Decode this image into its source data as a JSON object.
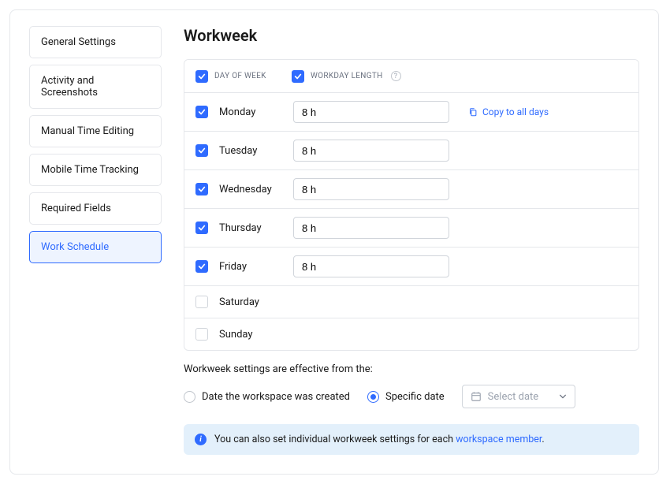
{
  "sidebar": {
    "items": [
      {
        "label": "General Settings",
        "active": false
      },
      {
        "label": "Activity and Screenshots",
        "active": false
      },
      {
        "label": "Manual Time Editing",
        "active": false
      },
      {
        "label": "Mobile Time Tracking",
        "active": false
      },
      {
        "label": "Required Fields",
        "active": false
      },
      {
        "label": "Work Schedule",
        "active": true
      }
    ]
  },
  "page": {
    "title": "Workweek"
  },
  "table": {
    "col_day": "Day of Week",
    "col_len": "Workday Length",
    "header_check_day": true,
    "header_check_len": true,
    "copy_label": "Copy to all days",
    "days": [
      {
        "name": "Monday",
        "checked": true,
        "length": "8 h",
        "show_copy": true
      },
      {
        "name": "Tuesday",
        "checked": true,
        "length": "8 h",
        "show_copy": false
      },
      {
        "name": "Wednesday",
        "checked": true,
        "length": "8 h",
        "show_copy": false
      },
      {
        "name": "Thursday",
        "checked": true,
        "length": "8 h",
        "show_copy": false
      },
      {
        "name": "Friday",
        "checked": true,
        "length": "8 h",
        "show_copy": false
      },
      {
        "name": "Saturday",
        "checked": false,
        "length": "",
        "show_copy": false
      },
      {
        "name": "Sunday",
        "checked": false,
        "length": "",
        "show_copy": false
      }
    ]
  },
  "effective": {
    "text": "Workweek settings are effective from the:",
    "opt_created": "Date the workspace was created",
    "opt_specific": "Specific date",
    "selected": "specific",
    "date_placeholder": "Select date"
  },
  "info": {
    "text_prefix": "You can also set individual workweek settings for each ",
    "link": "workspace member",
    "text_suffix": "."
  }
}
